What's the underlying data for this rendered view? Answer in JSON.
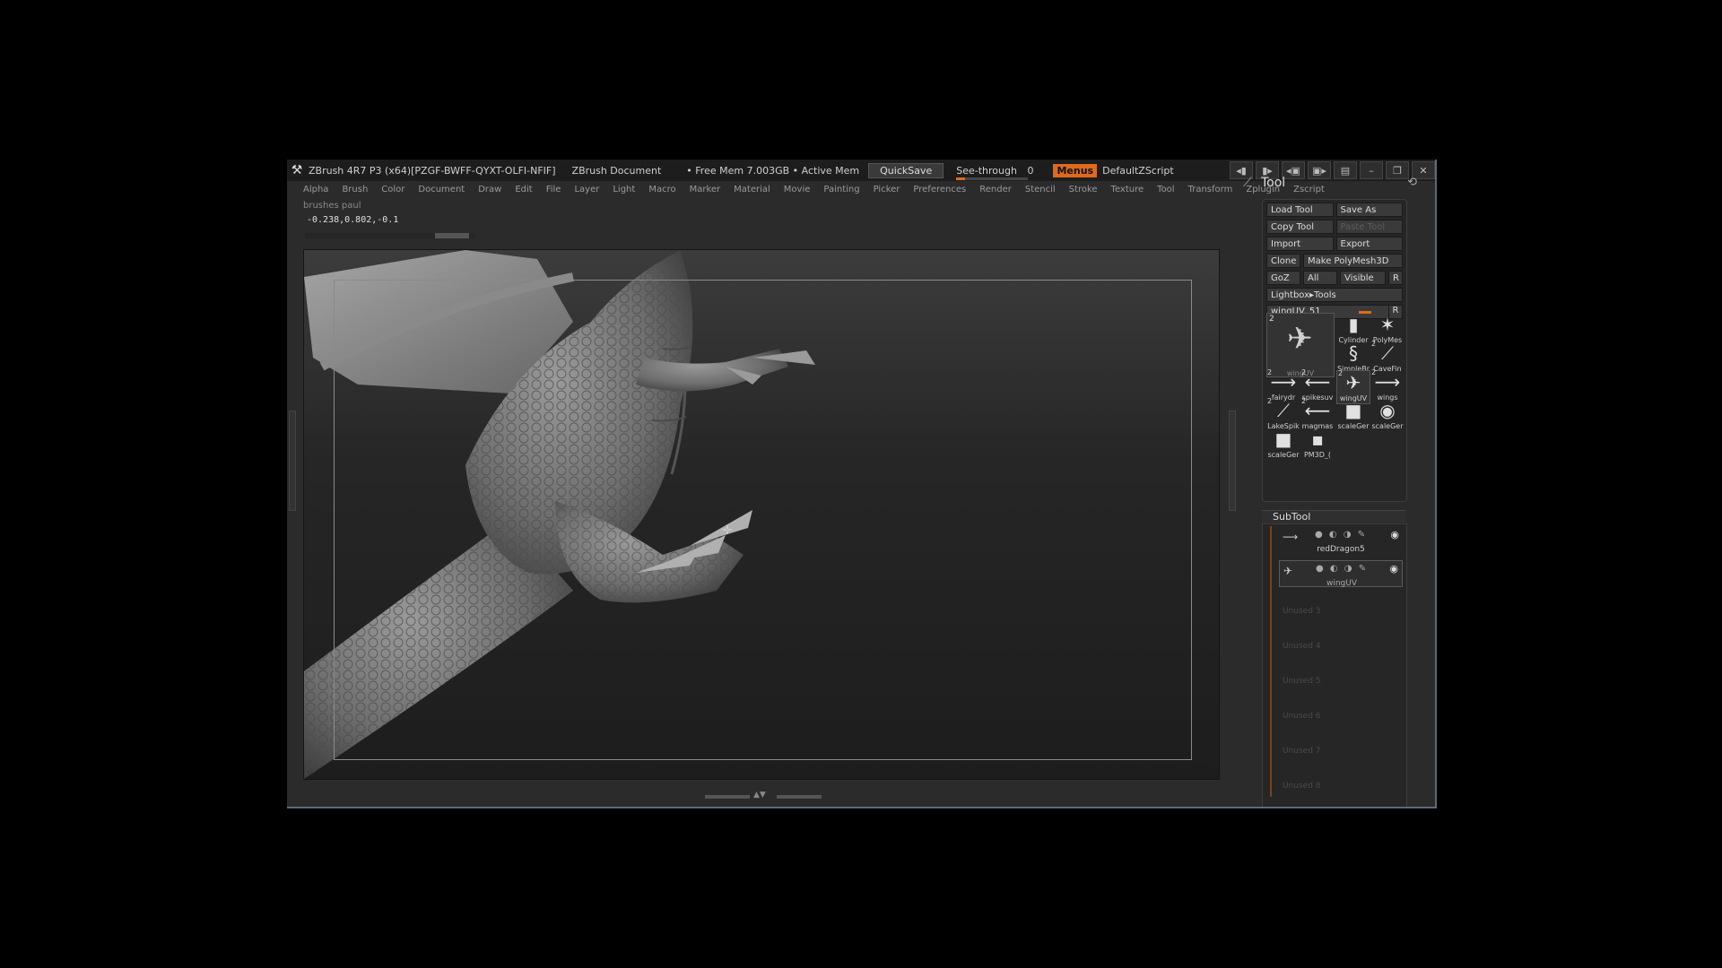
{
  "titlebar": {
    "app": "ZBrush 4R7 P3 (x64)[PZGF-BWFF-QYXT-OLFI-NFIF]",
    "document": "ZBrush Document",
    "memory": "• Free Mem 7.003GB • Active Mem",
    "quicksave": "QuickSave",
    "seethrough": "See-through",
    "seethrough_value": "0",
    "menus": "Menus",
    "script": "DefaultZScript"
  },
  "menubar": [
    "Alpha",
    "Brush",
    "Color",
    "Document",
    "Draw",
    "Edit",
    "File",
    "Layer",
    "Light",
    "Macro",
    "Marker",
    "Material",
    "Movie",
    "Painting",
    "Picker",
    "Preferences",
    "Render",
    "Stencil",
    "Stroke",
    "Texture",
    "Tool",
    "Transform",
    "Zplugin",
    "Zscript"
  ],
  "subinfo": "brushes  paul",
  "coordinates": "-0.238,0.802,-0.1",
  "tool": {
    "title": "Tool",
    "load": "Load Tool",
    "save_as": "Save As",
    "copy": "Copy Tool",
    "paste": "Paste Tool",
    "import": "Import",
    "export": "Export",
    "clone": "Clone",
    "make_polymesh": "Make PolyMesh3D",
    "goz": "GoZ",
    "all": "All",
    "visible": "Visible",
    "r": "R",
    "lightbox": "Lightbox▸Tools",
    "current": "wingUV. 51",
    "big_thumb": {
      "num": "2",
      "caption": "wingUV"
    },
    "thumbs": [
      {
        "name": "Cylinder",
        "num": ""
      },
      {
        "name": "PolyMes",
        "num": ""
      },
      {
        "name": "SimpleBr",
        "num": ""
      },
      {
        "name": "CaveFin",
        "num": "2"
      },
      {
        "name": "fairydr",
        "num": "2"
      },
      {
        "name": "spikesuv",
        "num": "2"
      },
      {
        "name": "wingUV",
        "num": "2"
      },
      {
        "name": "wings",
        "num": "2"
      },
      {
        "name": "LakeSpik",
        "num": "2"
      },
      {
        "name": "magmas",
        "num": "2"
      },
      {
        "name": "scaleGer",
        "num": ""
      },
      {
        "name": "scaleGer",
        "num": ""
      },
      {
        "name": "scaleGer",
        "num": ""
      },
      {
        "name": "PM3D_(",
        "num": ""
      }
    ]
  },
  "subtool": {
    "title": "SubTool",
    "items": [
      {
        "name": "redDragon5"
      },
      {
        "name": "wingUV"
      }
    ],
    "unused": [
      "Unused 3",
      "Unused 4",
      "Unused 5",
      "Unused 6",
      "Unused 7",
      "Unused 8"
    ]
  }
}
